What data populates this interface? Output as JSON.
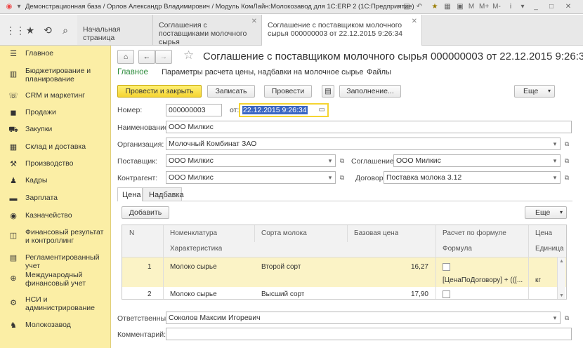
{
  "window": {
    "title": "Демонстрационная база / Орлов Александр Владимирович / Модуль КомЛайн:Молокозавод для 1С:ERP 2  (1С:Предприятие)"
  },
  "tabs": [
    {
      "label": "Начальная страница"
    },
    {
      "label": "Соглашения с поставщиками молочного сырья"
    },
    {
      "label": "Соглашение с поставщиком молочного сырья 000000003 от 22.12.2015 9:26:34"
    }
  ],
  "sidebar": {
    "items": [
      {
        "label": "Главное",
        "icon": "menu-icon"
      },
      {
        "label": "Бюджетирование и планирование",
        "icon": "budget-icon"
      },
      {
        "label": "CRM и маркетинг",
        "icon": "crm-icon"
      },
      {
        "label": "Продажи",
        "icon": "sales-icon"
      },
      {
        "label": "Закупки",
        "icon": "cart-icon"
      },
      {
        "label": "Склад и доставка",
        "icon": "warehouse-icon"
      },
      {
        "label": "Производство",
        "icon": "production-icon"
      },
      {
        "label": "Кадры",
        "icon": "staff-icon"
      },
      {
        "label": "Зарплата",
        "icon": "salary-icon"
      },
      {
        "label": "Казначейство",
        "icon": "treasury-icon"
      },
      {
        "label": "Финансовый результат и контроллинг",
        "icon": "finance-icon"
      },
      {
        "label": "Регламентированный учет",
        "icon": "accounting-icon"
      },
      {
        "label": "Международный финансовый учет",
        "icon": "intl-finance-icon"
      },
      {
        "label": "НСИ и администрирование",
        "icon": "settings-icon"
      },
      {
        "label": "Молокозавод",
        "icon": "dairy-icon"
      }
    ]
  },
  "doc": {
    "title": "Соглашение с поставщиком молочного сырья 000000003 от 22.12.2015 9:26:34",
    "subnav": [
      "Главное",
      "Параметры расчета цены, надбавки на молочное сырье",
      "Файлы"
    ],
    "toolbar": {
      "post_close": "Провести и закрыть",
      "save": "Записать",
      "post": "Провести",
      "fill": "Заполнение...",
      "more": "Еще"
    },
    "number_label": "Номер:",
    "number": "000000003",
    "date_label": "от:",
    "date": "22.12.2015  9:26:34",
    "name_label": "Наименование:",
    "name": "ООО Милкис",
    "org_label": "Организация:",
    "org": "Молочный Комбинат ЗАО",
    "supplier_label": "Поставщик:",
    "supplier": "ООО Милкис",
    "agreement_label": "Соглашение:",
    "agreement": "ООО Милкис",
    "counterparty_label": "Контрагент:",
    "counterparty": "ООО Милкис",
    "contract_label": "Договор:",
    "contract": "Поставка молока 3.12",
    "inner_tabs": [
      "Цена",
      "Надбавка"
    ],
    "add": "Добавить",
    "more2": "Еще",
    "columns": {
      "n": "N",
      "nom": "Номенклатура",
      "char": "Характеристика",
      "sort": "Сорта молока",
      "base": "Базовая цена",
      "calc": "Расчет по формуле",
      "formula": "Формула",
      "price": "Цена",
      "unit": "Единица"
    },
    "rows": [
      {
        "n": "1",
        "nom": "Молоко сырье",
        "sort": "Второй сорт",
        "base": "16,27",
        "formula": "[ЦенаПоДоговору] + (([...",
        "unit": "кг"
      },
      {
        "n": "2",
        "nom": "Молоко сырье",
        "sort": "Высший сорт",
        "base": "17,90"
      }
    ],
    "responsible_label": "Ответственный:",
    "responsible": "Соколов Максим Игоревич",
    "comment_label": "Комментарий:",
    "comment": ""
  }
}
